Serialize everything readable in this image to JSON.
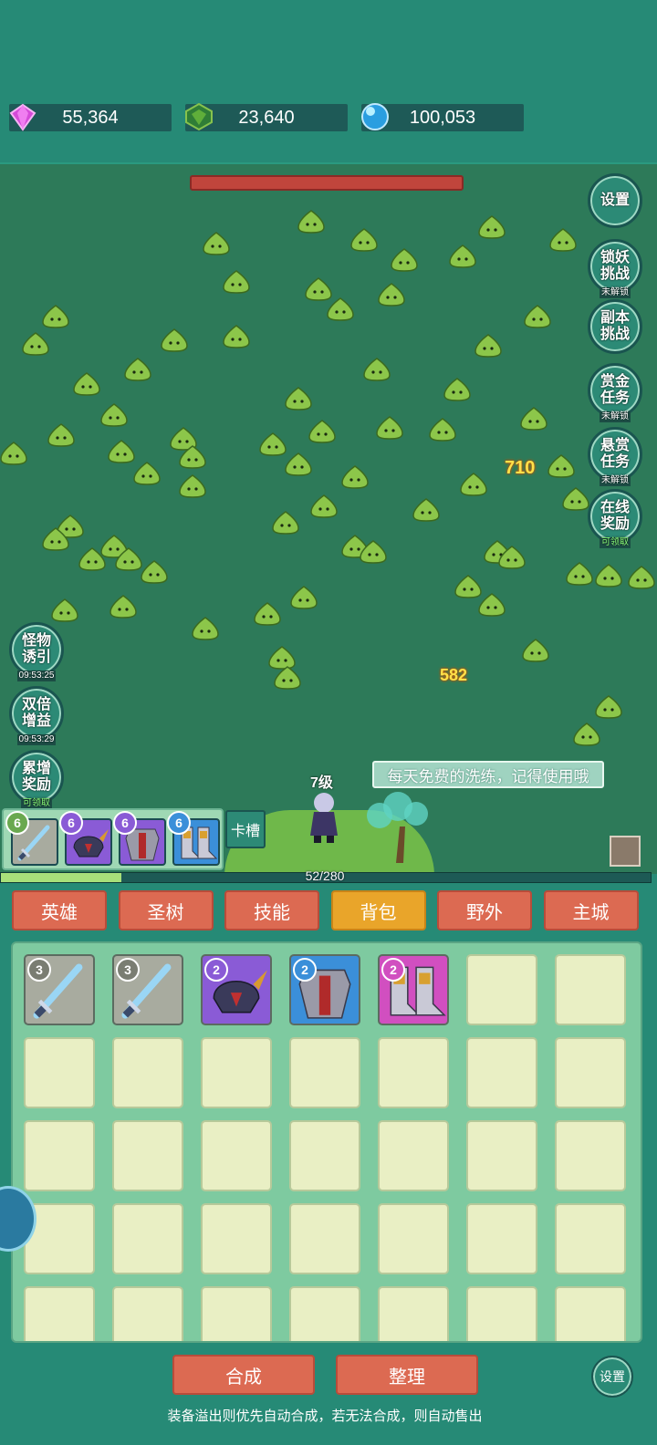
{
  "currencies": [
    {
      "icon": "purple-gem-icon",
      "value": "55,364"
    },
    {
      "icon": "green-gem-icon",
      "value": "23,640"
    },
    {
      "icon": "blue-orb-icon",
      "value": "100,053"
    }
  ],
  "right_buttons": [
    {
      "label": "设置",
      "sub": ""
    },
    {
      "label": "锁妖\n挑战",
      "sub": "未解锁"
    },
    {
      "label": "副本\n挑战",
      "sub": ""
    },
    {
      "label": "赏金\n任务",
      "sub": "未解锁"
    },
    {
      "label": "悬赏\n任务",
      "sub": "未解锁"
    },
    {
      "label": "在线\n奖励",
      "sub": "可领取"
    }
  ],
  "left_buttons": [
    {
      "label": "怪物\n诱引",
      "sub": "09:53:25"
    },
    {
      "label": "双倍\n增益",
      "sub": "09:53:29"
    },
    {
      "label": "累增\n奖励",
      "sub": "可领取"
    }
  ],
  "damage_numbers": [
    "710",
    "582"
  ],
  "hero": {
    "level": "7级"
  },
  "tip": "每天免费的洗练，记得使用哦",
  "equipped": [
    {
      "level": "6",
      "item": "sword-icon"
    },
    {
      "level": "6",
      "item": "helmet-icon"
    },
    {
      "level": "6",
      "item": "armor-icon"
    },
    {
      "level": "6",
      "item": "boots-icon"
    }
  ],
  "card_slot_label": "卡槽",
  "progress": {
    "text": "52/280",
    "fraction": 0.186
  },
  "tabs": [
    {
      "label": "英雄",
      "active": false
    },
    {
      "label": "圣树",
      "active": false
    },
    {
      "label": "技能",
      "active": false
    },
    {
      "label": "背包",
      "active": true
    },
    {
      "label": "野外",
      "active": false
    },
    {
      "label": "主城",
      "active": false
    }
  ],
  "inventory": [
    {
      "level": "3",
      "item": "sword-icon",
      "color": "#a8ab9f"
    },
    {
      "level": "3",
      "item": "sword-icon",
      "color": "#a8ab9f"
    },
    {
      "level": "2",
      "item": "helmet-icon",
      "color": "#8a5bd6"
    },
    {
      "level": "2",
      "item": "armor-icon",
      "color": "#3b8fd9"
    },
    {
      "level": "2",
      "item": "boots-icon",
      "color": "#d14fc0"
    }
  ],
  "buttons": {
    "merge": "合成",
    "sort": "整理",
    "settings": "设置"
  },
  "footer_note": "装备溢出则优先自动合成，若无法合成，则自动售出",
  "colors": {
    "background": "#268a76",
    "field": "#2d7a59",
    "tab": "#dc6a52",
    "tab_active": "#e9a52a"
  }
}
